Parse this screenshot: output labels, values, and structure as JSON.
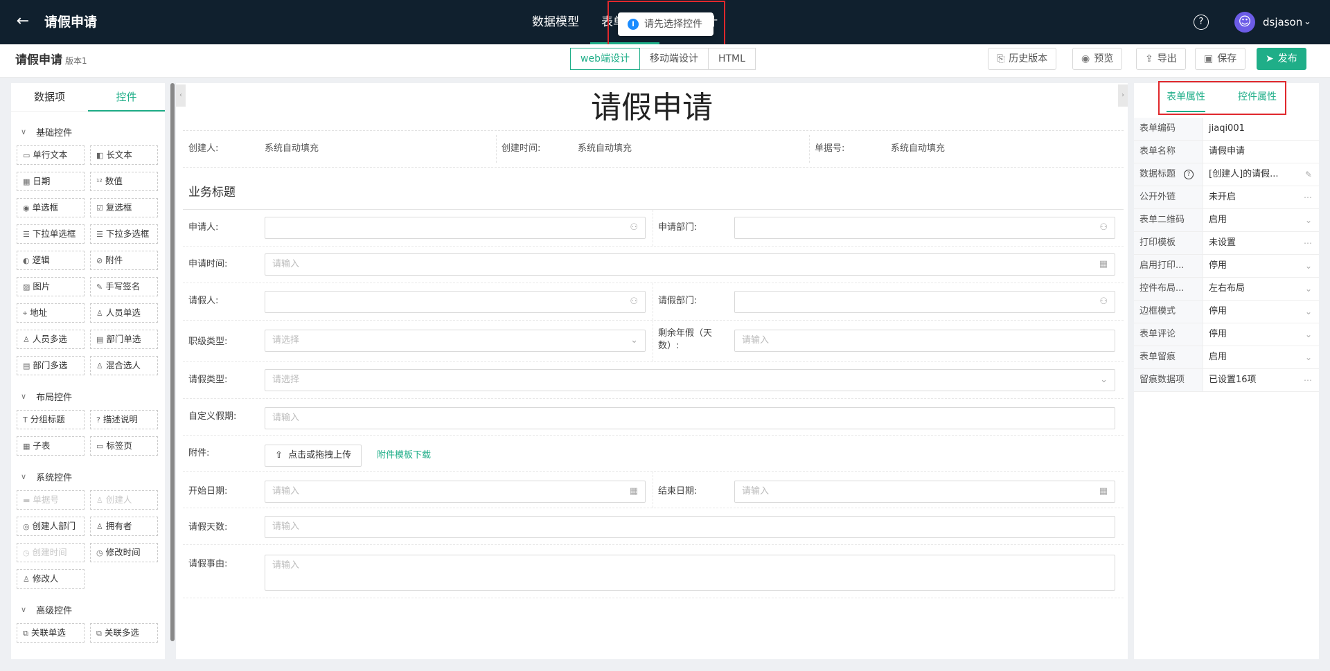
{
  "topbar": {
    "title": "请假申请",
    "tabs": [
      {
        "label": "数据模型"
      },
      {
        "label": "表单设计"
      },
      {
        "label": "视图设计"
      }
    ],
    "toast": "请先选择控件",
    "user": "dsjason"
  },
  "subbar": {
    "form_name": "请假申请",
    "version": "版本1",
    "design_tabs": [
      "web端设计",
      "移动端设计",
      "HTML"
    ],
    "actions": {
      "history": "历史版本",
      "preview": "预览",
      "export": "导出",
      "save": "保存",
      "publish": "发布"
    }
  },
  "left": {
    "tabs": [
      "数据项",
      "控件"
    ],
    "groups": [
      {
        "title": "基础控件",
        "items": [
          "单行文本",
          "长文本",
          "日期",
          "数值",
          "单选框",
          "复选框",
          "下拉单选框",
          "下拉多选框",
          "逻辑",
          "附件",
          "图片",
          "手写签名",
          "地址",
          "人员单选",
          "人员多选",
          "部门单选",
          "部门多选",
          "混合选人"
        ]
      },
      {
        "title": "布局控件",
        "items": [
          "分组标题",
          "描述说明",
          "子表",
          "标签页"
        ]
      },
      {
        "title": "系统控件",
        "items": [
          "单据号",
          "创建人",
          "创建人部门",
          "拥有者",
          "创建时间",
          "修改时间",
          "修改人"
        ]
      },
      {
        "title": "高级控件",
        "items": [
          "关联单选",
          "关联多选"
        ]
      }
    ]
  },
  "canvas": {
    "title": "请假申请",
    "info": {
      "creator_label": "创建人:",
      "creator_value": "系统自动填充",
      "time_label": "创建时间:",
      "time_value": "系统自动填充",
      "doc_label": "单据号:",
      "doc_value": "系统自动填充"
    },
    "section": "业务标题",
    "fields": {
      "applicant": "申请人:",
      "apply_dept": "申请部门:",
      "apply_time": "申请时间:",
      "leave_person": "请假人:",
      "leave_dept": "请假部门:",
      "rank_type": "职级类型:",
      "remaining_line1": "剩余年假（天",
      "remaining_line2": "数）:",
      "leave_type": "请假类型:",
      "custom_period": "自定义假期:",
      "attachment": "附件:",
      "start_date": "开始日期:",
      "end_date": "结束日期:",
      "leave_days": "请假天数:",
      "reason": "请假事由:"
    },
    "placeholder_input": "请输入",
    "placeholder_select": "请选择",
    "upload_label": "点击或拖拽上传",
    "template_link": "附件模板下载"
  },
  "right": {
    "tabs": [
      "表单属性",
      "控件属性"
    ],
    "props": [
      {
        "key": "表单编码",
        "value": "jiaqi001"
      },
      {
        "key": "表单名称",
        "value": "请假申请"
      },
      {
        "key": "数据标题",
        "value": "[创建人]的请假..."
      },
      {
        "key": "公开外链",
        "value": "未开启"
      },
      {
        "key": "表单二维码",
        "value": "启用"
      },
      {
        "key": "打印模板",
        "value": "未设置"
      },
      {
        "key": "启用打印...",
        "value": "停用"
      },
      {
        "key": "控件布局...",
        "value": "左右布局"
      },
      {
        "key": "边框模式",
        "value": "停用"
      },
      {
        "key": "表单评论",
        "value": "停用"
      },
      {
        "key": "表单留痕",
        "value": "启用"
      },
      {
        "key": "留痕数据项",
        "value": "已设置16项"
      }
    ]
  },
  "colors": {
    "accent": "#1fae88",
    "topbar": "#10202e",
    "highlight": "#e0282c"
  }
}
